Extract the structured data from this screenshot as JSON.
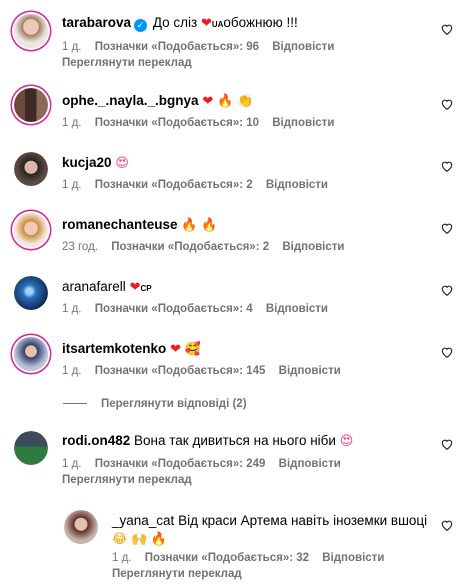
{
  "comments": [
    {
      "user": "tarabarova",
      "text": "До сліз",
      "text2": "обожнюю !!!",
      "flag": "UA",
      "time": "1 д.",
      "likes": "Позначки «Подобається»: 96",
      "reply": "Відповісти",
      "translate": "Переглянути переклад"
    },
    {
      "user": "ophe._.nayla._.bgnya",
      "time": "1 д.",
      "likes": "Позначки «Подобається»: 10",
      "reply": "Відповісти"
    },
    {
      "user": "kucja20",
      "time": "1 д.",
      "likes": "Позначки «Подобається»: 2",
      "reply": "Відповісти"
    },
    {
      "user": "romanechanteuse",
      "time": "23 год.",
      "likes": "Позначки «Подобається»: 2",
      "reply": "Відповісти"
    },
    {
      "user": "aranafarell",
      "flag": "CP",
      "time": "1 д.",
      "likes": "Позначки «Подобається»: 4",
      "reply": "Відповісти"
    },
    {
      "user": "itsartemkotenko",
      "time": "1 д.",
      "likes": "Позначки «Подобається»: 145",
      "reply": "Відповісти"
    },
    {
      "user": "rodi.on482",
      "text": "Вона так дивиться на нього ніби",
      "time": "1 д.",
      "likes": "Позначки «Подобається»: 249",
      "reply": "Відповісти",
      "translate": "Переглянути переклад"
    },
    {
      "user": "_yana_cat",
      "text": "Від краси Артема навіть іноземки вшоці",
      "time": "1 д.",
      "likes": "Позначки «Подобається»: 32",
      "reply": "Відповісти",
      "translate": "Переглянути переклад"
    }
  ],
  "view_replies": "Переглянути відповіді (2)",
  "icons": {
    "like": "heart-outline-icon",
    "verified": "verified-badge-icon"
  },
  "colors": {
    "meta": "#737373",
    "verified": "#0095f6",
    "heart": "#ed1c24"
  }
}
